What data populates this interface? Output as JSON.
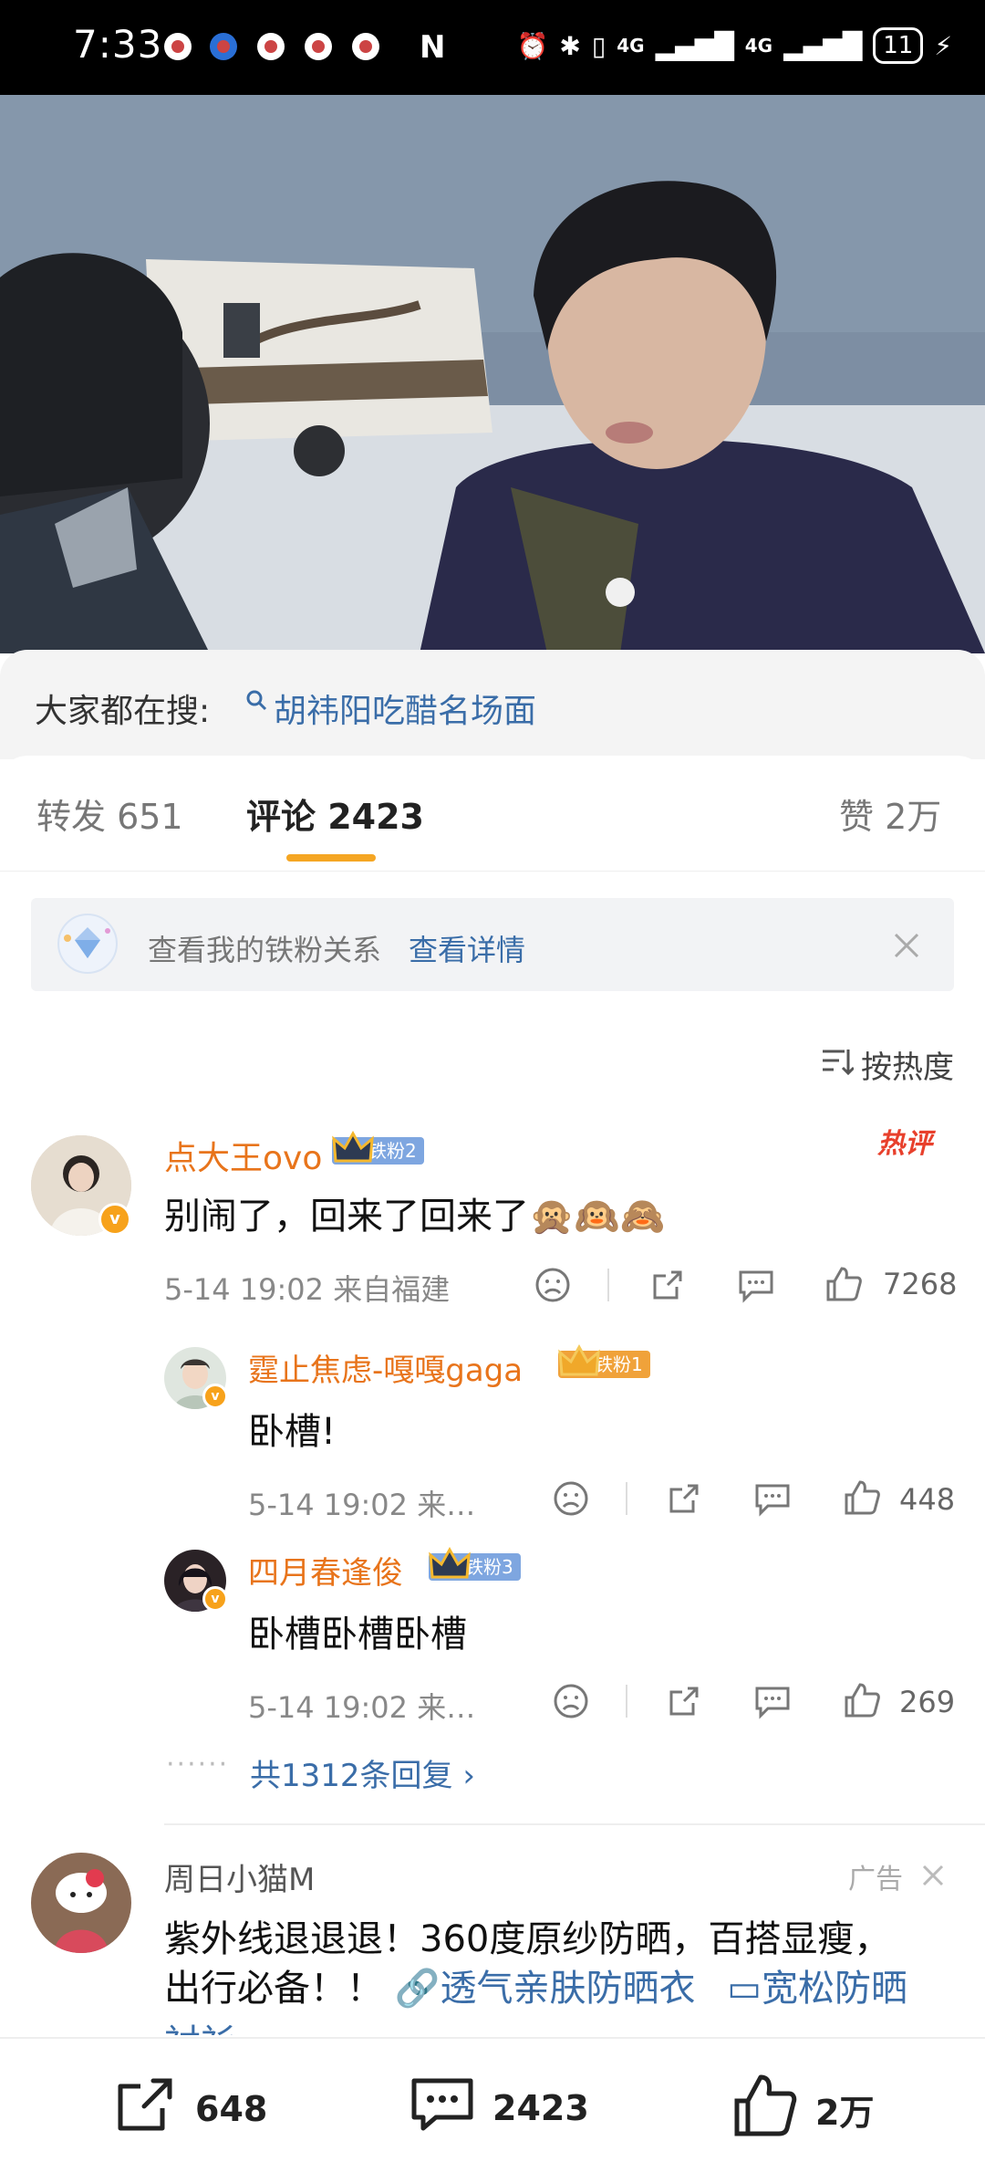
{
  "status_bar": {
    "time": "7:33",
    "network1": "4G",
    "network2": "4G",
    "battery": "11"
  },
  "search": {
    "label": "大家都在搜:",
    "term": "胡祎阳吃醋名场面"
  },
  "tabs": {
    "repost": "转发 651",
    "comment": "评论 2423",
    "like": "赞 2万"
  },
  "fans_banner": {
    "text": "查看我的铁粉关系",
    "link": "查看详情"
  },
  "sort": {
    "label": "按热度"
  },
  "comments": [
    {
      "username": "点大王ovo",
      "fan_badge": "铁粉2",
      "hot_tag": "热评",
      "text": "别闹了，回来了回来了🙊🙉🙈",
      "time_location": "5-14 19:02  来自福建",
      "likes": "7268",
      "replies": [
        {
          "username": "霆止焦虑-嘎嘎gaga",
          "fan_badge": "铁粉1",
          "text": "卧槽!",
          "time_location": "5-14 19:02  来…",
          "likes": "448"
        },
        {
          "username": "四月春逢俊",
          "fan_badge": "铁粉3",
          "text": "卧槽卧槽卧槽",
          "time_location": "5-14 19:02  来…",
          "likes": "269"
        }
      ],
      "more_replies": "共1312条回复 ›"
    }
  ],
  "ad": {
    "username": "周日小猫M",
    "label": "广告",
    "text_line1": "紫外线退退退！360度原纱防晒，百搭显瘦，",
    "text_line2_prefix": "出行必备！！ ",
    "link1": "🔗透气亲肤防晒衣",
    "link2": "▭宽松防晒",
    "text_line3": "衬衫"
  },
  "bottom_bar": {
    "repost_count": "648",
    "comment_count": "2423",
    "like_count": "2万"
  },
  "colors": {
    "username": "#e8741b",
    "link": "#3a6da8",
    "tab_underline": "#f5a623",
    "hot_tag": "#e8402c",
    "fan_badge": "#7ea6e0"
  }
}
